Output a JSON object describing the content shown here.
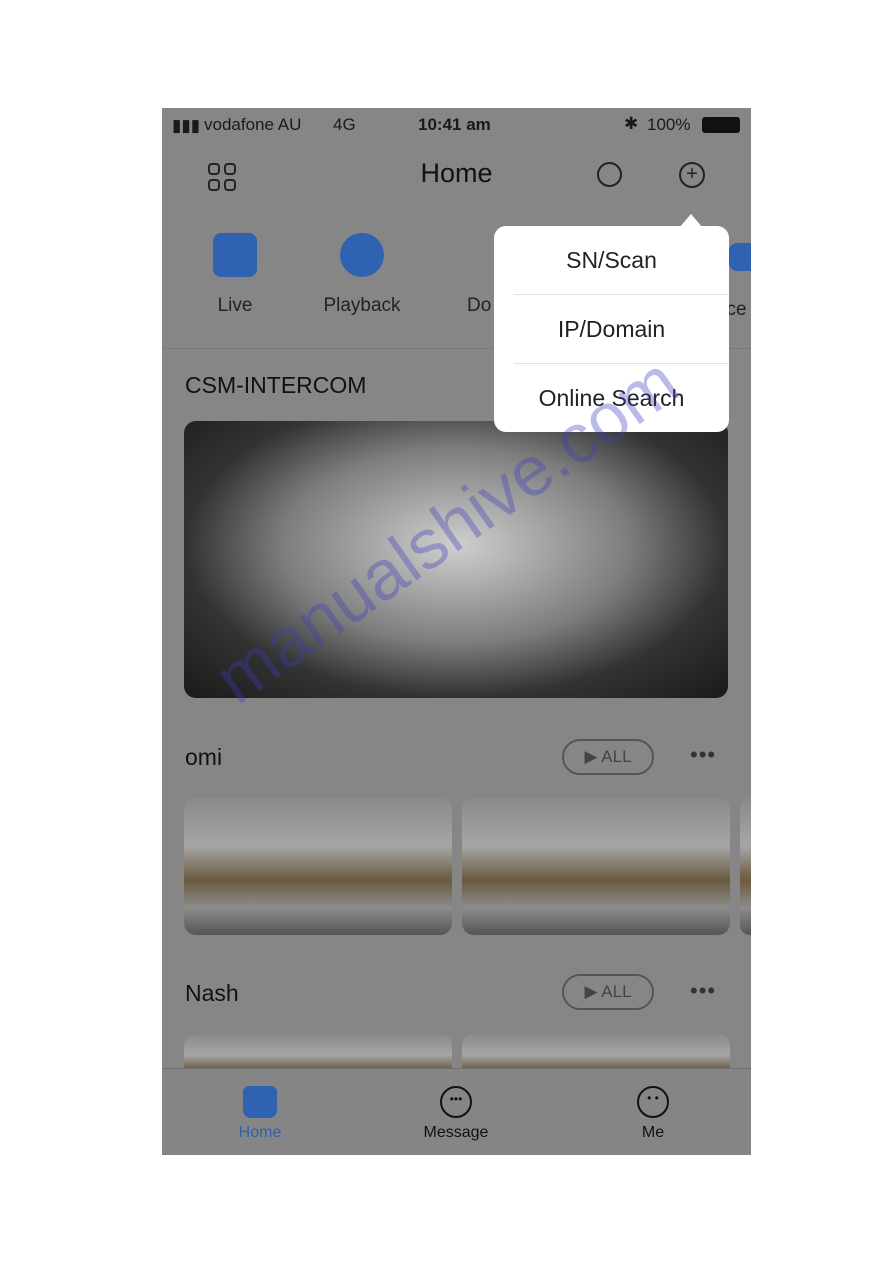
{
  "status": {
    "carrier": "vodafone AU",
    "network": "4G",
    "time": "10:41 am",
    "battery": "100%"
  },
  "header": {
    "title": "Home",
    "icons": [
      "grid-icon",
      "search-icon",
      "add-circle-icon"
    ]
  },
  "quick_actions": [
    {
      "label": "Live",
      "icon": "dome-camera-icon"
    },
    {
      "label": "Playback",
      "icon": "playback-icon"
    },
    {
      "label": "Do",
      "icon": "door-station-icon"
    },
    {
      "label": "cce",
      "icon": "access-icon"
    }
  ],
  "add_menu": {
    "items": [
      "SN/Scan",
      "IP/Domain",
      "Online Search"
    ]
  },
  "devices": [
    {
      "name": "CSM-INTERCOM"
    },
    {
      "name": "omi",
      "all_label": "ALL"
    },
    {
      "name": "Nash",
      "all_label": "ALL"
    }
  ],
  "tabbar": {
    "items": [
      {
        "label": "Home",
        "active": true
      },
      {
        "label": "Message"
      },
      {
        "label": "Me"
      }
    ]
  },
  "colors": {
    "accent": "#2f62b0",
    "overlay": "#868686"
  },
  "watermark": "manualshive.com"
}
